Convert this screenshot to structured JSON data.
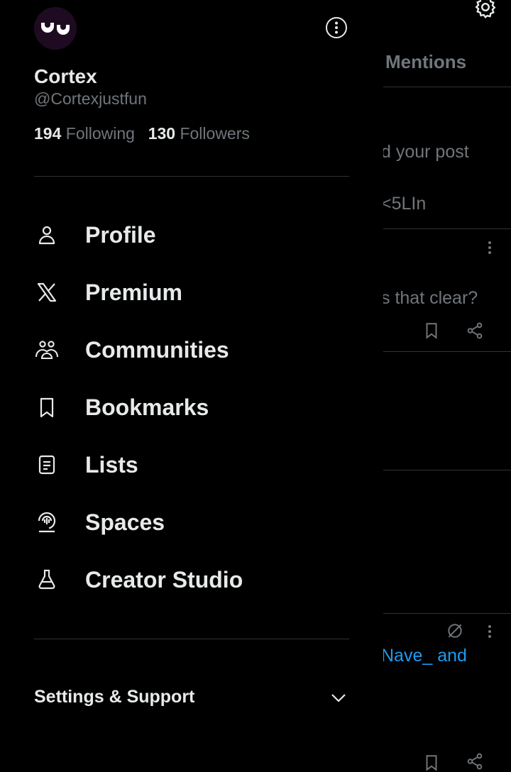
{
  "background": {
    "tab_mentions": "Mentions",
    "snippet_1": "d your post",
    "snippet_2": "<5LIn",
    "snippet_3": "s that clear?",
    "snippet_4": "Nave_ and"
  },
  "drawer": {
    "user": {
      "name": "Cortex",
      "handle": "@Cortexjustfun",
      "following_count": "194",
      "following_label": "Following",
      "followers_count": "130",
      "followers_label": "Followers"
    },
    "menu": [
      {
        "label": "Profile",
        "icon": "person-icon"
      },
      {
        "label": "Premium",
        "icon": "x-logo-icon"
      },
      {
        "label": "Communities",
        "icon": "communities-icon"
      },
      {
        "label": "Bookmarks",
        "icon": "bookmark-icon"
      },
      {
        "label": "Lists",
        "icon": "list-icon"
      },
      {
        "label": "Spaces",
        "icon": "spaces-icon"
      },
      {
        "label": "Creator Studio",
        "icon": "flask-icon"
      }
    ],
    "settings_label": "Settings & Support"
  },
  "colors": {
    "background": "#000000",
    "primary_text": "#e7e9ea",
    "secondary_text": "#71767b",
    "divider": "#2f3336",
    "link": "#1d9bf0"
  }
}
